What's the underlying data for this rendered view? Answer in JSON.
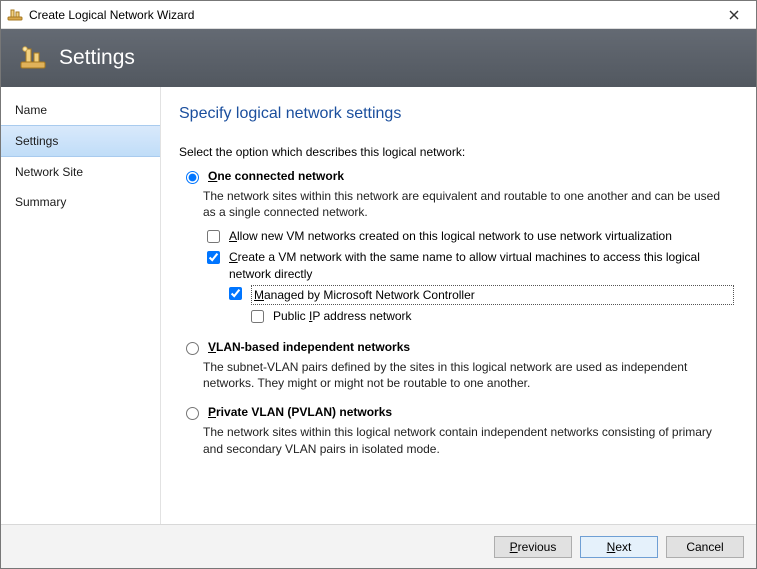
{
  "window": {
    "title": "Create Logical Network Wizard"
  },
  "banner": {
    "title": "Settings"
  },
  "sidebar": {
    "items": [
      {
        "label": "Name"
      },
      {
        "label": "Settings"
      },
      {
        "label": "Network Site"
      },
      {
        "label": "Summary"
      }
    ]
  },
  "main": {
    "title": "Specify logical network settings",
    "intro": "Select the option which describes this logical network:",
    "options": {
      "one_connected": {
        "label_pre": "O",
        "label_rest": "ne connected network",
        "desc": "The network sites within this network are equivalent and routable to one another and can be used as a single connected network.",
        "allow_virt_pre": "A",
        "allow_virt_rest": "llow new VM networks created on this logical network to use network virtualization",
        "create_vmnet_pre": "C",
        "create_vmnet_rest": "reate a VM network with the same name to allow virtual machines to access this logical network directly",
        "managed_pre": "M",
        "managed_rest": "anaged by Microsoft Network Controller",
        "public_ip_pre_a": "Public ",
        "public_ip_u": "I",
        "public_ip_post": "P address network"
      },
      "vlan": {
        "label_pre": "V",
        "label_rest": "LAN-based independent networks",
        "desc": "The subnet-VLAN pairs defined by the sites in this logical network are used as independent networks. They might or might not be routable to one another."
      },
      "pvlan": {
        "label_pre": "P",
        "label_rest": "rivate VLAN (PVLAN) networks",
        "desc": "The network sites within this logical network contain independent networks consisting of primary and secondary VLAN pairs in isolated mode."
      }
    }
  },
  "footer": {
    "previous_u": "P",
    "previous_rest": "revious",
    "next_u": "N",
    "next_rest": "ext",
    "cancel": "Cancel"
  }
}
